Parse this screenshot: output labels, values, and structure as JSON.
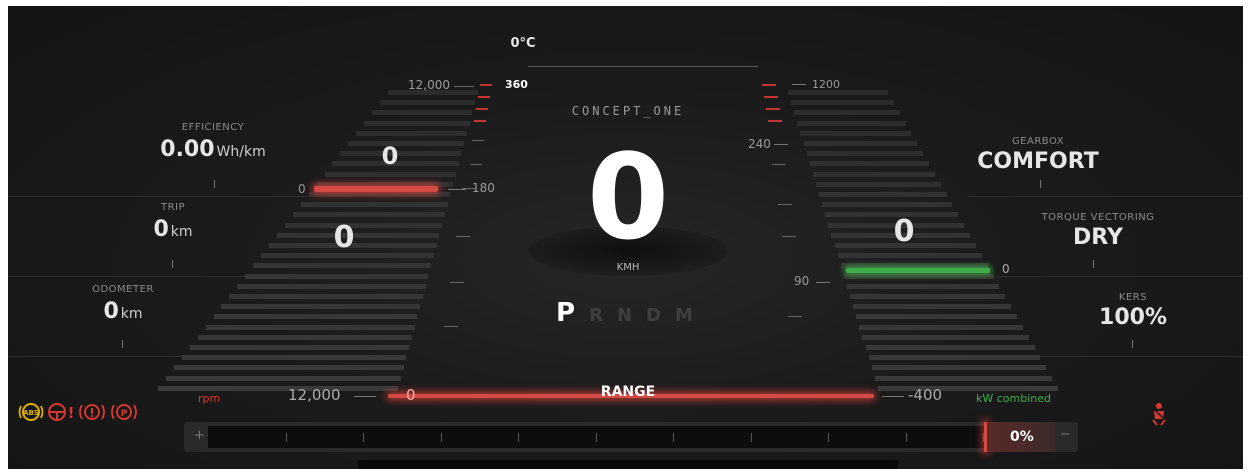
{
  "temperature": "0°C",
  "brand_logo_text": "CONCEPT_ONE",
  "speed": {
    "value": "0",
    "unit": "KMH"
  },
  "gear_selector": {
    "active": "P",
    "others": [
      "R",
      "N",
      "D",
      "M"
    ]
  },
  "left_panel": {
    "efficiency": {
      "label": "EFFICIENCY",
      "value": "0.00",
      "unit": "Wh/km"
    },
    "trip": {
      "label": "TRIP",
      "value": "0",
      "unit": "km"
    },
    "odometer": {
      "label": "ODOMETER",
      "value": "0",
      "unit": "km"
    }
  },
  "right_panel": {
    "gearbox": {
      "label": "GEARBOX",
      "value": "COMFORT"
    },
    "torque_vectoring": {
      "label": "TORQUE VECTORING",
      "value": "DRY"
    },
    "kers": {
      "label": "KERS",
      "value": "100%"
    }
  },
  "left_gauge": {
    "max_label": "12,000",
    "zero_label": "0",
    "upper_value": "0",
    "lower_value": "0",
    "bottom_label": "12,000",
    "unit_label": "rpm"
  },
  "center_scale_left": {
    "top": "360",
    "mid": "180"
  },
  "center_scale_right": {
    "top": "1200",
    "upper": "240",
    "mid": "90"
  },
  "right_gauge": {
    "value": "0",
    "zero_label": "0",
    "bottom_label": "-400",
    "unit_label": "kW combined"
  },
  "range_bar": {
    "label": "RANGE",
    "zero_label": "0"
  },
  "battery_bar": {
    "plus": "+",
    "minus": "−",
    "percent": "0%",
    "level": 0
  },
  "warning_icons": [
    "abs-icon",
    "steering-warning-icon",
    "brake-warning-icon",
    "parking-brake-icon"
  ],
  "seatbelt_icon": "seatbelt-icon",
  "colors": {
    "red": "#d44a44",
    "green": "#3fae4a",
    "amber": "#e0b000",
    "warning_red": "#d6382f"
  }
}
